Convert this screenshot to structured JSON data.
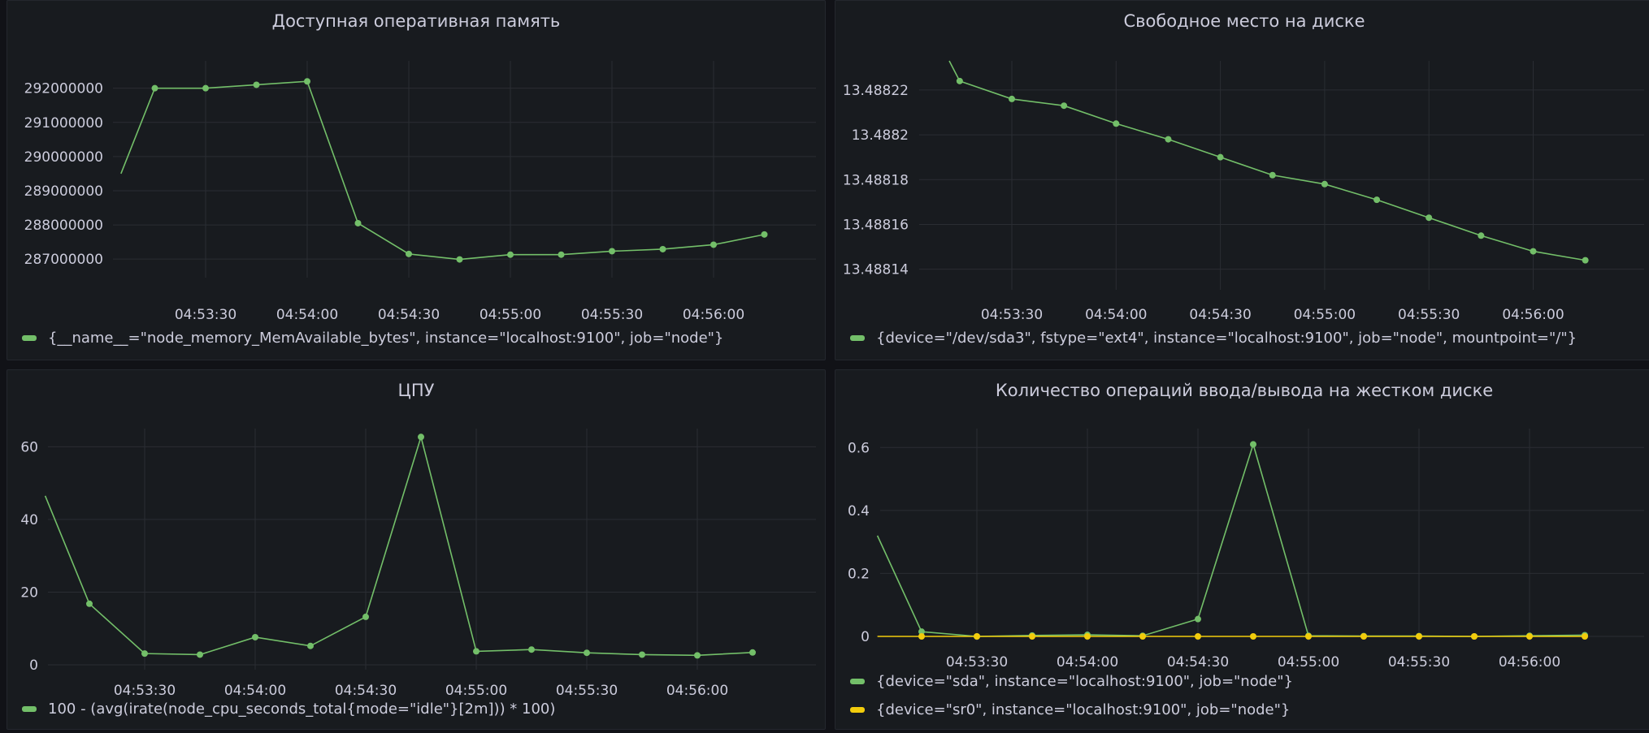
{
  "panels": [
    {
      "title": "Доступная оперативная память",
      "legend": [
        {
          "label": "{__name__=\"node_memory_MemAvailable_bytes\", instance=\"localhost:9100\", job=\"node\"}",
          "color": "#73bf69"
        }
      ]
    },
    {
      "title": "Свободное место на диске",
      "legend": [
        {
          "label": "{device=\"/dev/sda3\", fstype=\"ext4\", instance=\"localhost:9100\", job=\"node\", mountpoint=\"/\"}",
          "color": "#73bf69"
        }
      ]
    },
    {
      "title": "ЦПУ",
      "legend": [
        {
          "label": "100 - (avg(irate(node_cpu_seconds_total{mode=\"idle\"}[2m])) * 100)",
          "color": "#73bf69"
        }
      ]
    },
    {
      "title": "Количество операций ввода/вывода на жестком диске",
      "legend": [
        {
          "label": "{device=\"sda\", instance=\"localhost:9100\", job=\"node\"}",
          "color": "#73bf69"
        },
        {
          "label": "{device=\"sr0\", instance=\"localhost:9100\", job=\"node\"}",
          "color": "#f2cc0c"
        }
      ]
    }
  ],
  "chart_data": [
    {
      "type": "line",
      "title": "Доступная оперативная память",
      "x_ticks": [
        "04:53:30",
        "04:54:00",
        "04:54:30",
        "04:55:00",
        "04:55:30",
        "04:56:00"
      ],
      "y_ticks": [
        "287000000",
        "288000000",
        "289000000",
        "290000000",
        "291000000",
        "292000000"
      ],
      "ylim": [
        286600000,
        292800000
      ],
      "grid": true,
      "legend_position": "bottom",
      "x": [
        "04:53:05",
        "04:53:15",
        "04:53:30",
        "04:53:45",
        "04:54:00",
        "04:54:15",
        "04:54:30",
        "04:54:45",
        "04:55:00",
        "04:55:15",
        "04:55:30",
        "04:55:45",
        "04:56:00",
        "04:56:15"
      ],
      "series": [
        {
          "name": "{__name__=\"node_memory_MemAvailable_bytes\", instance=\"localhost:9100\", job=\"node\"}",
          "color": "#73bf69",
          "values": [
            289500000,
            292000000,
            292000000,
            292100000,
            292200000,
            288050000,
            287150000,
            286990000,
            287130000,
            287130000,
            287230000,
            287290000,
            287420000,
            287720000
          ],
          "markers": [
            false,
            true,
            true,
            true,
            true,
            true,
            true,
            true,
            true,
            true,
            true,
            true,
            true,
            true
          ]
        }
      ]
    },
    {
      "type": "line",
      "title": "Свободное место на диске",
      "x_ticks": [
        "04:53:30",
        "04:54:00",
        "04:54:30",
        "04:55:00",
        "04:55:30",
        "04:56:00"
      ],
      "y_ticks": [
        "13.48814",
        "13.48816",
        "13.48818",
        "13.4882",
        "13.48822"
      ],
      "ylim": [
        13.488133,
        13.488233
      ],
      "grid": true,
      "legend_position": "bottom",
      "x": [
        "04:53:12",
        "04:53:15",
        "04:53:30",
        "04:53:45",
        "04:54:00",
        "04:54:15",
        "04:54:30",
        "04:54:45",
        "04:55:00",
        "04:55:15",
        "04:55:30",
        "04:55:45",
        "04:56:00",
        "04:56:15"
      ],
      "series": [
        {
          "name": "{device=\"/dev/sda3\", fstype=\"ext4\", instance=\"localhost:9100\", job=\"node\", mountpoint=\"/\"}",
          "color": "#73bf69",
          "values": [
            13.488233,
            13.488224,
            13.488216,
            13.488213,
            13.488205,
            13.488198,
            13.48819,
            13.488182,
            13.488178,
            13.488171,
            13.488163,
            13.488155,
            13.488148,
            13.488144
          ],
          "markers": [
            false,
            true,
            true,
            true,
            true,
            true,
            true,
            true,
            true,
            true,
            true,
            true,
            true,
            true
          ]
        }
      ]
    },
    {
      "type": "line",
      "title": "ЦПУ",
      "x_ticks": [
        "04:53:30",
        "04:54:00",
        "04:54:30",
        "04:55:00",
        "04:55:30",
        "04:56:00"
      ],
      "y_ticks": [
        "0",
        "20",
        "40",
        "60"
      ],
      "ylim": [
        0,
        65
      ],
      "grid": true,
      "legend_position": "bottom",
      "x": [
        "04:53:03",
        "04:53:15",
        "04:53:30",
        "04:53:45",
        "04:54:00",
        "04:54:15",
        "04:54:30",
        "04:54:45",
        "04:55:00",
        "04:55:15",
        "04:55:30",
        "04:55:45",
        "04:56:00",
        "04:56:15"
      ],
      "series": [
        {
          "name": "100 - (avg(irate(node_cpu_seconds_total{mode=\"idle\"}[2m])) * 100)",
          "color": "#73bf69",
          "values": [
            46.5,
            16.8,
            3.1,
            2.8,
            7.6,
            5.2,
            13.2,
            62.7,
            3.7,
            4.2,
            3.3,
            2.8,
            2.6,
            3.4
          ],
          "markers": [
            false,
            true,
            true,
            true,
            true,
            true,
            true,
            true,
            true,
            true,
            true,
            true,
            true,
            true
          ]
        }
      ]
    },
    {
      "type": "line",
      "title": "Количество операций ввода/вывода на жестком диске",
      "x_ticks": [
        "04:53:30",
        "04:54:00",
        "04:54:30",
        "04:55:00",
        "04:55:30",
        "04:56:00"
      ],
      "y_ticks": [
        "0",
        "0.2",
        "0.4",
        "0.6"
      ],
      "ylim": [
        0,
        0.66
      ],
      "grid": true,
      "legend_position": "bottom",
      "x": [
        "04:53:03",
        "04:53:15",
        "04:53:30",
        "04:53:45",
        "04:54:00",
        "04:54:15",
        "04:54:30",
        "04:54:45",
        "04:55:00",
        "04:55:15",
        "04:55:30",
        "04:55:45",
        "04:56:00",
        "04:56:15"
      ],
      "series": [
        {
          "name": "{device=\"sda\", instance=\"localhost:9100\", job=\"node\"}",
          "color": "#73bf69",
          "values": [
            0.32,
            0.015,
            0,
            0.003,
            0.005,
            0.002,
            0.055,
            0.61,
            0.002,
            0.001,
            0.001,
            0,
            0.002,
            0.004
          ],
          "markers": [
            false,
            true,
            true,
            true,
            true,
            true,
            true,
            true,
            true,
            true,
            true,
            true,
            true,
            true
          ]
        },
        {
          "name": "{device=\"sr0\", instance=\"localhost:9100\", job=\"node\"}",
          "color": "#f2cc0c",
          "values": [
            0,
            0,
            0,
            0,
            0,
            0,
            0,
            0,
            0,
            0,
            0,
            0,
            0,
            0
          ],
          "markers": [
            false,
            true,
            true,
            true,
            true,
            true,
            true,
            true,
            true,
            true,
            true,
            true,
            true,
            true
          ]
        }
      ]
    }
  ]
}
